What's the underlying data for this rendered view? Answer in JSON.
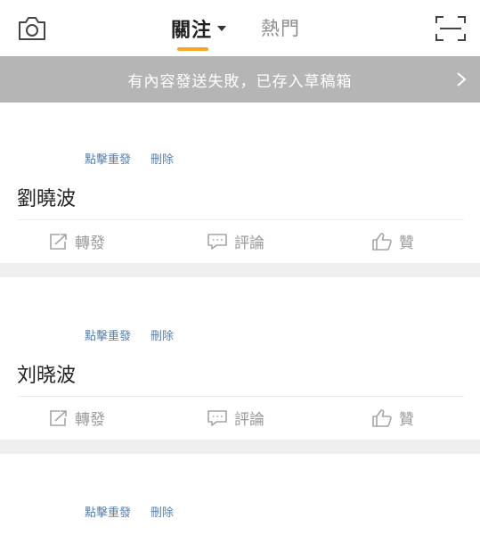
{
  "header": {
    "tab_follow": "關注",
    "tab_hot": "熱門",
    "active_color": "#f6a623"
  },
  "banner": {
    "text": "有內容發送失敗，已存入草稿箱"
  },
  "posts": [
    {
      "retry": "點擊重發",
      "delete": "刪除",
      "text": "劉曉波",
      "repost": "轉發",
      "comment": "評論",
      "like": "贊"
    },
    {
      "retry": "點擊重發",
      "delete": "刪除",
      "text": "刘晓波",
      "repost": "轉發",
      "comment": "評論",
      "like": "贊"
    },
    {
      "retry": "點擊重發",
      "delete": "刪除"
    }
  ]
}
